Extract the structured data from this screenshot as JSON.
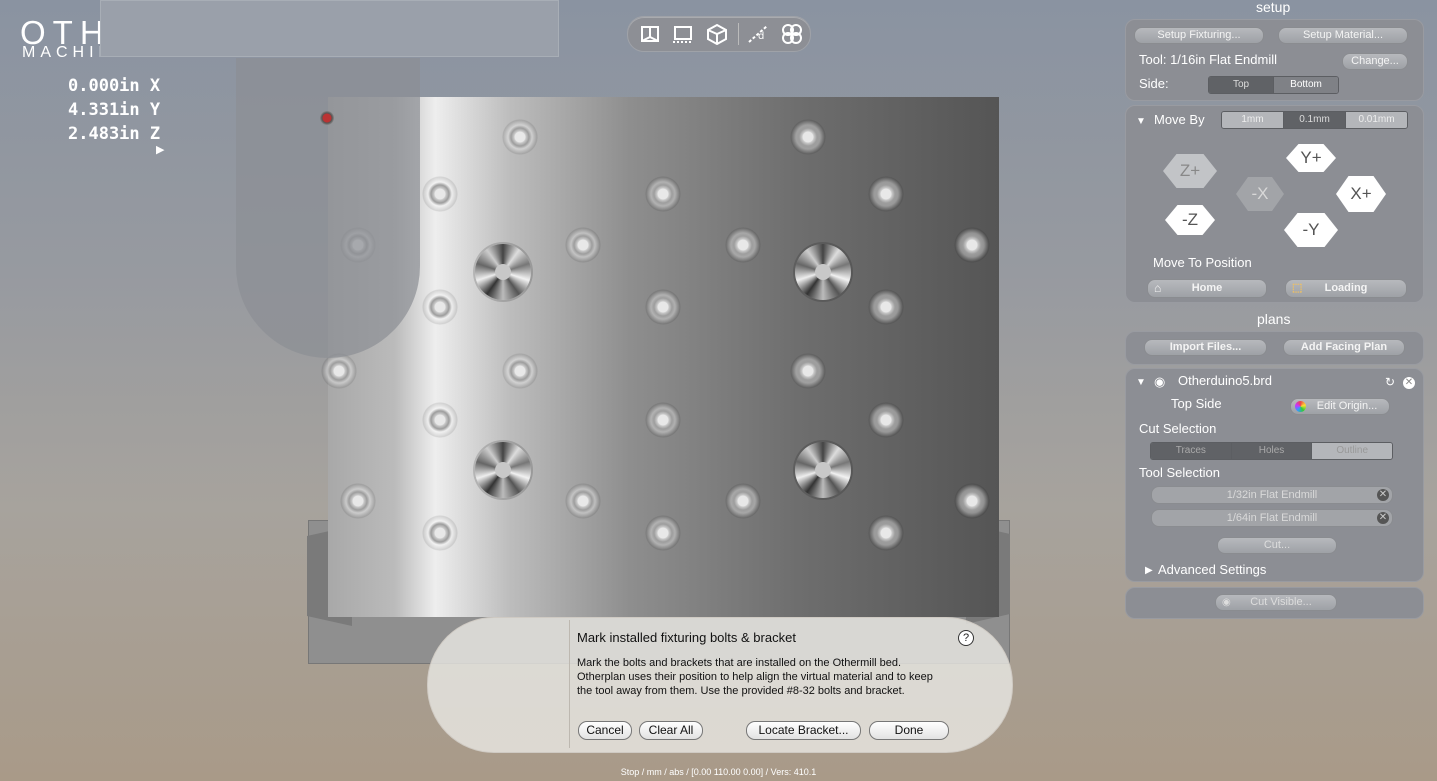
{
  "logo": {
    "line1": "OTHER",
    "line2": "MACHINE Co"
  },
  "coords": {
    "x": "0.000in X",
    "y": "4.331in Y",
    "z": "2.483in Z",
    "expand": "▶"
  },
  "toolbar": {
    "icons": [
      "book-view-icon",
      "top-view-icon",
      "3d-view-icon",
      "measure-icon",
      "bolt-fixture-icon"
    ]
  },
  "dialog": {
    "title": "Mark installed fixturing bolts & bracket",
    "help": "?",
    "body": "Mark the bolts and brackets that are installed on the Othermill bed.\nOtherplan uses their position to help align the virtual material and to keep\nthe tool away from them.  Use the provided #8-32 bolts and bracket.",
    "cancel": "Cancel",
    "clear_all": "Clear All",
    "locate": "Locate Bracket...",
    "done": "Done"
  },
  "status": "Stop / mm / abs / [0.00 110.00 0.00] / Vers: 410.1",
  "setup": {
    "title": "setup",
    "fixturing": "Setup Fixturing...",
    "material": "Setup Material...",
    "tool": "Tool: 1/16in Flat Endmill",
    "change": "Change...",
    "side_label": "Side:",
    "side_top": "Top",
    "side_bottom": "Bottom"
  },
  "move": {
    "title": "Move By",
    "steps": [
      "1mm",
      "0.1mm",
      "0.01mm"
    ],
    "zplus": "Z+",
    "zminus": "-Z",
    "yplus": "Y+",
    "yminus": "-Y",
    "xplus": "X+",
    "xminus": "-X",
    "to_position": "Move To Position",
    "home": "Home",
    "loading": "Loading"
  },
  "plans": {
    "title": "plans",
    "import": "Import Files...",
    "facing": "Add Facing Plan",
    "file": "Otherduino5.brd",
    "side": "Top Side",
    "edit_origin": "Edit Origin...",
    "cut_selection": "Cut Selection",
    "cut_options": [
      "Traces",
      "Holes",
      "Outline"
    ],
    "tool_selection": "Tool Selection",
    "tools": [
      "1/32in Flat Endmill",
      "1/64in Flat Endmill"
    ],
    "cut": "Cut...",
    "advanced": "Advanced Settings",
    "cut_visible": "Cut Visible..."
  }
}
